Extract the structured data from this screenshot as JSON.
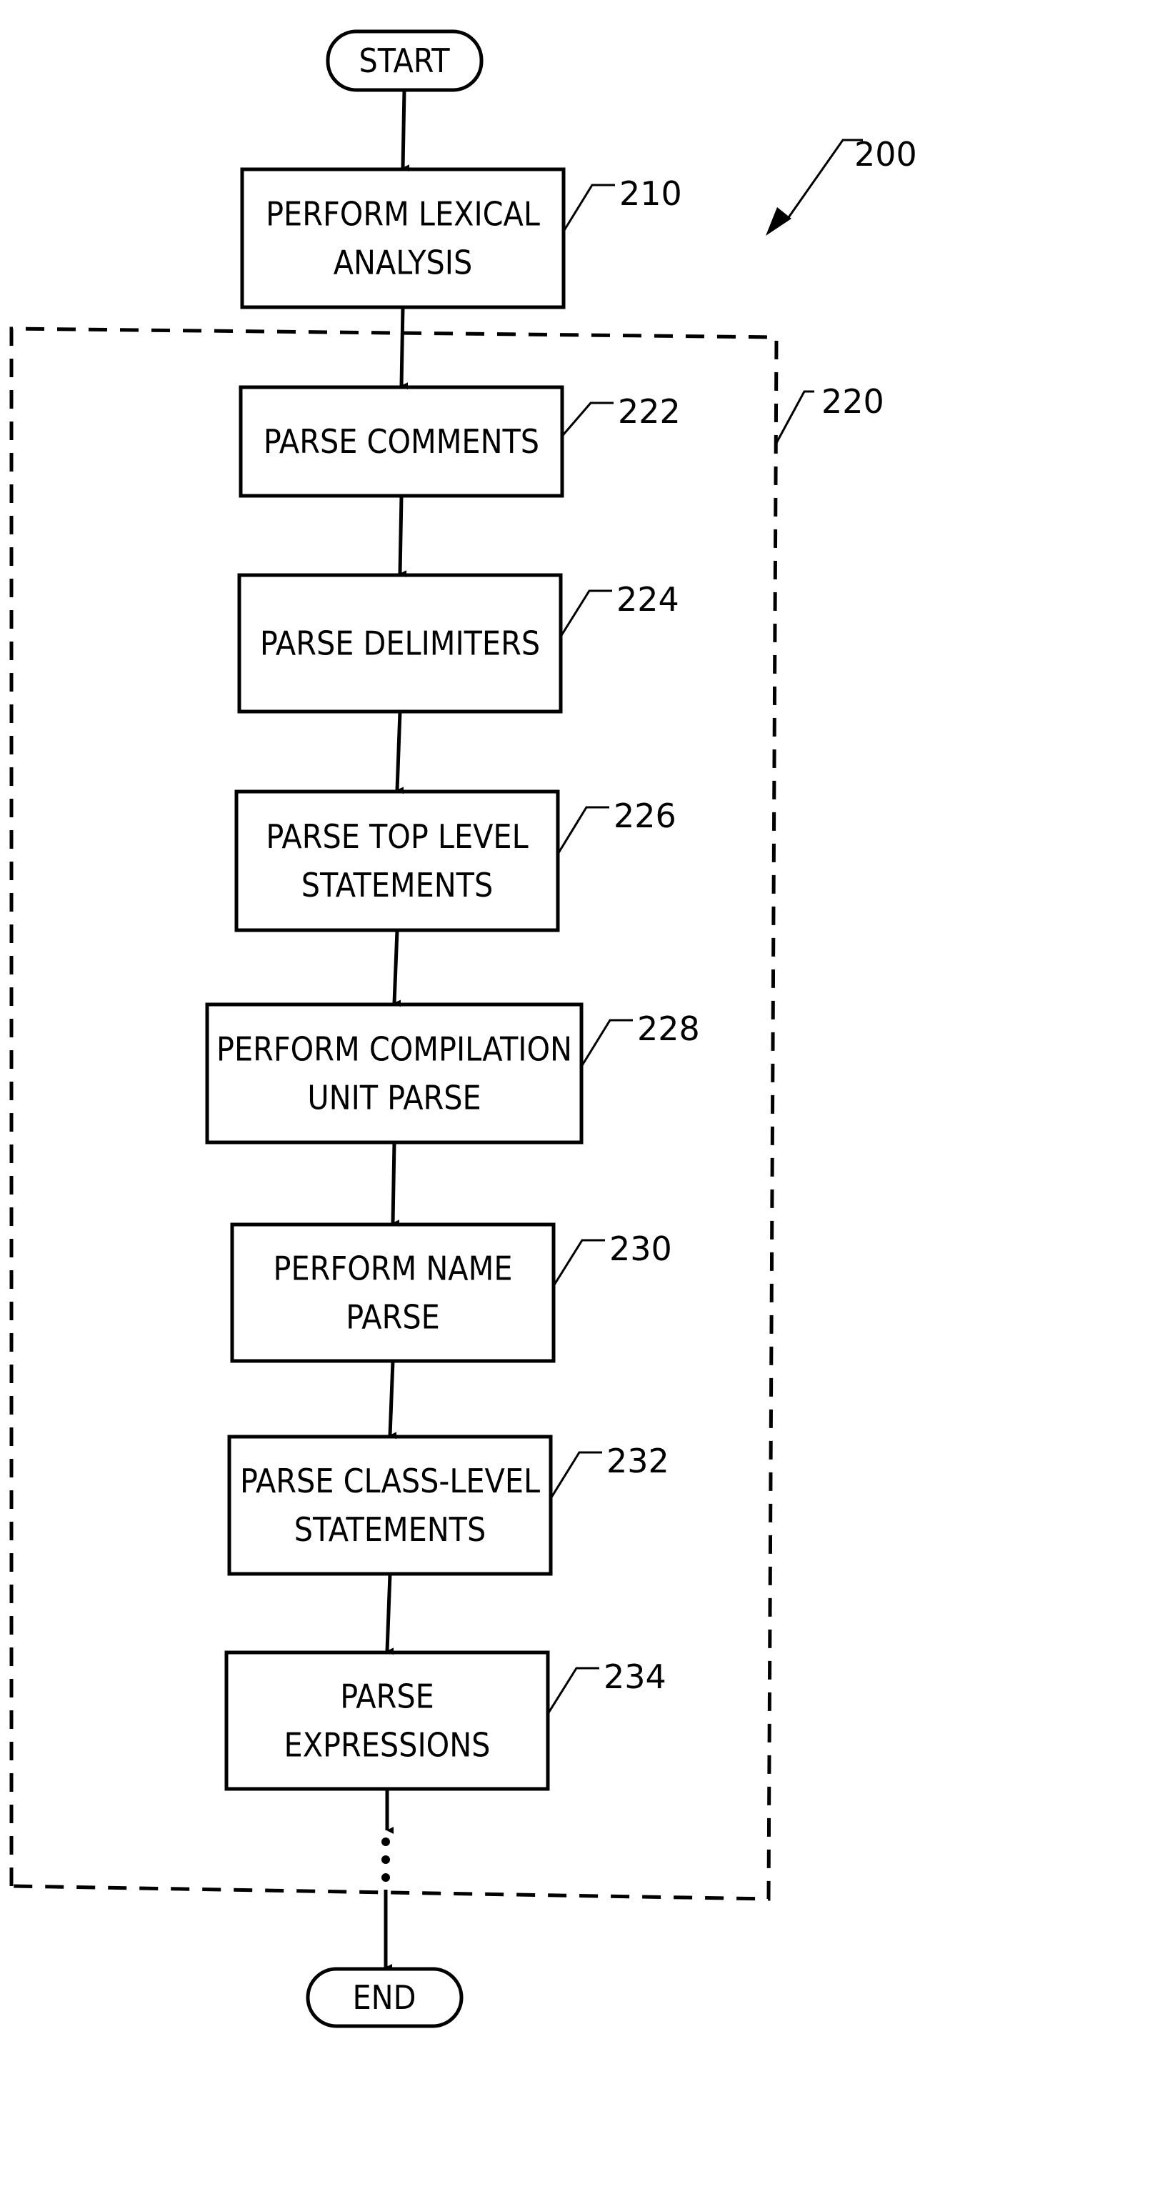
{
  "figure": {
    "reference": "200",
    "group_reference": "220",
    "start_label": "START",
    "end_label": "END",
    "steps": [
      {
        "ref": "210",
        "lines": [
          "PERFORM LEXICAL",
          "ANALYSIS"
        ],
        "in_group": false
      },
      {
        "ref": "222",
        "lines": [
          "PARSE COMMENTS"
        ],
        "in_group": true
      },
      {
        "ref": "224",
        "lines": [
          "PARSE DELIMITERS"
        ],
        "in_group": true
      },
      {
        "ref": "226",
        "lines": [
          "PARSE TOP LEVEL",
          "STATEMENTS"
        ],
        "in_group": true
      },
      {
        "ref": "228",
        "lines": [
          "PERFORM COMPILATION",
          "UNIT PARSE"
        ],
        "in_group": true
      },
      {
        "ref": "230",
        "lines": [
          "PERFORM NAME",
          "PARSE"
        ],
        "in_group": true
      },
      {
        "ref": "232",
        "lines": [
          "PARSE CLASS-LEVEL",
          "STATEMENTS"
        ],
        "in_group": true
      },
      {
        "ref": "234",
        "lines": [
          "PARSE",
          "EXPRESSIONS"
        ],
        "in_group": true
      }
    ],
    "continuation": "⋮"
  }
}
